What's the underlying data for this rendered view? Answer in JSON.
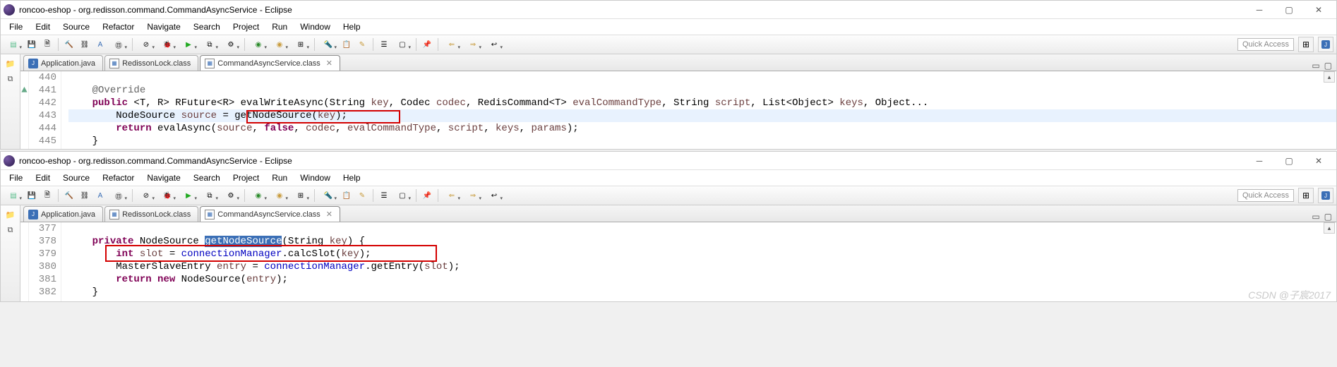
{
  "window1": {
    "title": "roncoo-eshop - org.redisson.command.CommandAsyncService - Eclipse",
    "menus": [
      "File",
      "Edit",
      "Source",
      "Refactor",
      "Navigate",
      "Search",
      "Project",
      "Run",
      "Window",
      "Help"
    ],
    "quick_access": "Quick Access",
    "tabs": [
      {
        "label": "Application.java",
        "icon": "java"
      },
      {
        "label": "RedissonLock.class",
        "icon": "class"
      },
      {
        "label": "CommandAsyncService.class",
        "icon": "class",
        "active": true
      }
    ],
    "lines": {
      "l440": "440",
      "l441": "441",
      "l442": "442",
      "l443": "443",
      "l444": "444",
      "l445": "445"
    },
    "code": {
      "c441_ann": "@Override",
      "c442_kw1": "public",
      "c442_tp": " <T, R> RFuture<R> evalWriteAsync(String ",
      "c442_p1": "key",
      "c442_t2": ", Codec ",
      "c442_p2": "codec",
      "c442_t3": ", RedisCommand<T> ",
      "c442_p3": "evalCommandType",
      "c442_t4": ", String ",
      "c442_p4": "script",
      "c442_t5": ", List<Object> ",
      "c442_p5": "keys",
      "c442_t6": ", Object...",
      "c443_t1": "NodeSource ",
      "c443_v1": "source",
      "c443_t2": " = ",
      "c443_fn": "getNodeSource",
      "c443_t3": "(",
      "c443_p": "key",
      "c443_t4": ");",
      "c444_kw": "return",
      "c444_t1": " evalAsync(",
      "c444_p1": "source",
      "c444_t2": ", ",
      "c444_kw2": "false",
      "c444_t3": ", ",
      "c444_p2": "codec",
      "c444_t4": ", ",
      "c444_p3": "evalCommandType",
      "c444_t5": ", ",
      "c444_p4": "script",
      "c444_t6": ", ",
      "c444_p5": "keys",
      "c444_t7": ", ",
      "c444_p6": "params",
      "c444_t8": ");",
      "c445": "}"
    }
  },
  "window2": {
    "title": "roncoo-eshop - org.redisson.command.CommandAsyncService - Eclipse",
    "menus": [
      "File",
      "Edit",
      "Source",
      "Refactor",
      "Navigate",
      "Search",
      "Project",
      "Run",
      "Window",
      "Help"
    ],
    "quick_access": "Quick Access",
    "tabs": [
      {
        "label": "Application.java",
        "icon": "java"
      },
      {
        "label": "RedissonLock.class",
        "icon": "class"
      },
      {
        "label": "CommandAsyncService.class",
        "icon": "class",
        "active": true
      }
    ],
    "lines": {
      "l377": "377",
      "l378": "378",
      "l379": "379",
      "l380": "380",
      "l381": "381",
      "l382": "382"
    },
    "code": {
      "c378_kw": "private",
      "c378_t1": " NodeSource ",
      "c378_sel": "getNodeSource",
      "c378_t2": "(String ",
      "c378_p": "key",
      "c378_t3": ") {",
      "c379_kw": "int",
      "c379_t1": " ",
      "c379_v": "slot",
      "c379_t2": " = ",
      "c379_f": "connectionManager",
      "c379_t3": ".calcSlot(",
      "c379_p": "key",
      "c379_t4": ");",
      "c380_t1": "MasterSlaveEntry ",
      "c380_v": "entry",
      "c380_t2": " = ",
      "c380_f": "connectionManager",
      "c380_t3": ".getEntry(",
      "c380_p": "slot",
      "c380_t4": ");",
      "c381_kw": "return",
      "c381_t1": " ",
      "c381_kw2": "new",
      "c381_t2": " NodeSource(",
      "c381_p": "entry",
      "c381_t3": ");",
      "c382": "}"
    },
    "watermark": "CSDN @子宸2017"
  }
}
